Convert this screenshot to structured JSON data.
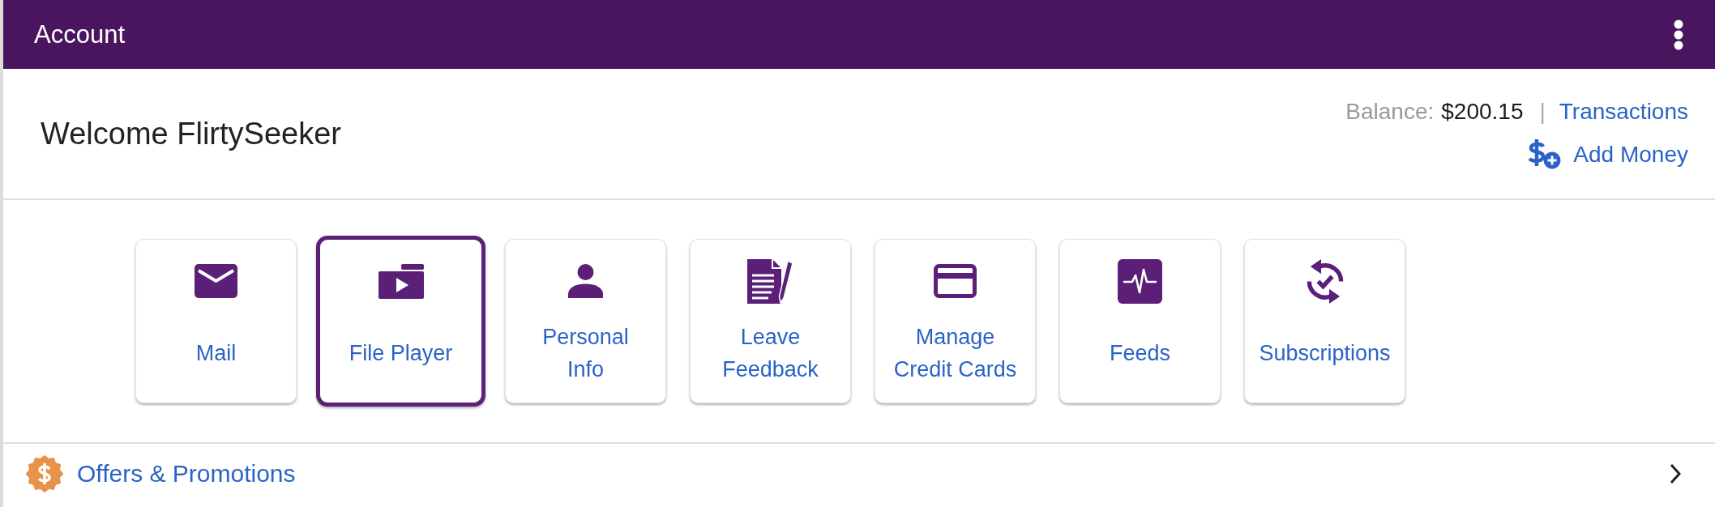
{
  "header": {
    "title": "Account"
  },
  "welcome": {
    "greeting": "Welcome FlirtySeeker",
    "balance_label": "Balance:",
    "balance_value": "$200.15",
    "separator": "|",
    "transactions_link": "Transactions",
    "add_money_link": "Add Money"
  },
  "tiles": [
    {
      "kind": "mail",
      "label": "Mail",
      "selected": false
    },
    {
      "kind": "file_player",
      "label": "File Player",
      "selected": true
    },
    {
      "kind": "personal",
      "label": "Personal\nInfo",
      "selected": false
    },
    {
      "kind": "feedback",
      "label": "Leave\nFeedback",
      "selected": false
    },
    {
      "kind": "credit_card",
      "label": "Manage\nCredit Cards",
      "selected": false
    },
    {
      "kind": "feeds",
      "label": "Feeds",
      "selected": false
    },
    {
      "kind": "subscriptions",
      "label": "Subscriptions",
      "selected": false
    }
  ],
  "offers": {
    "label": "Offers & Promotions"
  }
}
